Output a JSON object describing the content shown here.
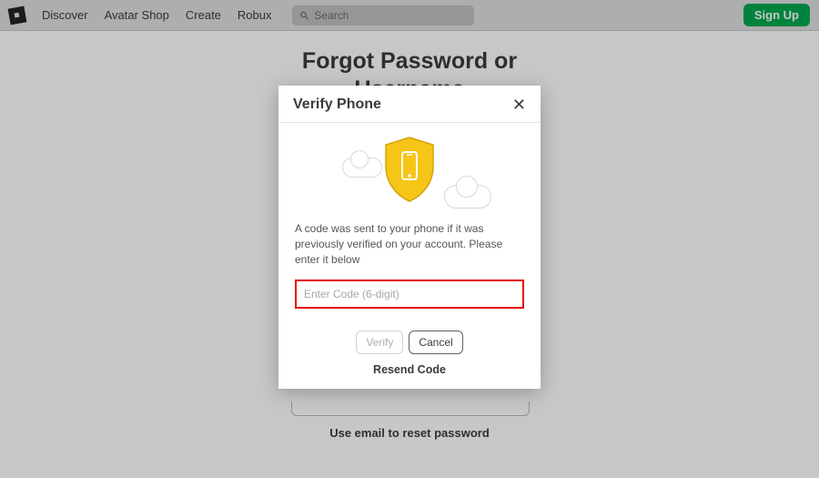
{
  "nav": {
    "items": [
      "Discover",
      "Avatar Shop",
      "Create",
      "Robux"
    ],
    "search_placeholder": "Search",
    "signup_label": "Sign Up"
  },
  "page": {
    "title_line1": "Forgot Password or",
    "title_line2": "Username",
    "email_reset_label": "Use email to reset password"
  },
  "modal": {
    "title": "Verify Phone",
    "description": "A code was sent to your phone if it was previously verified on your account. Please enter it below",
    "code_placeholder": "Enter Code (6-digit)",
    "verify_label": "Verify",
    "cancel_label": "Cancel",
    "resend_label": "Resend Code"
  }
}
